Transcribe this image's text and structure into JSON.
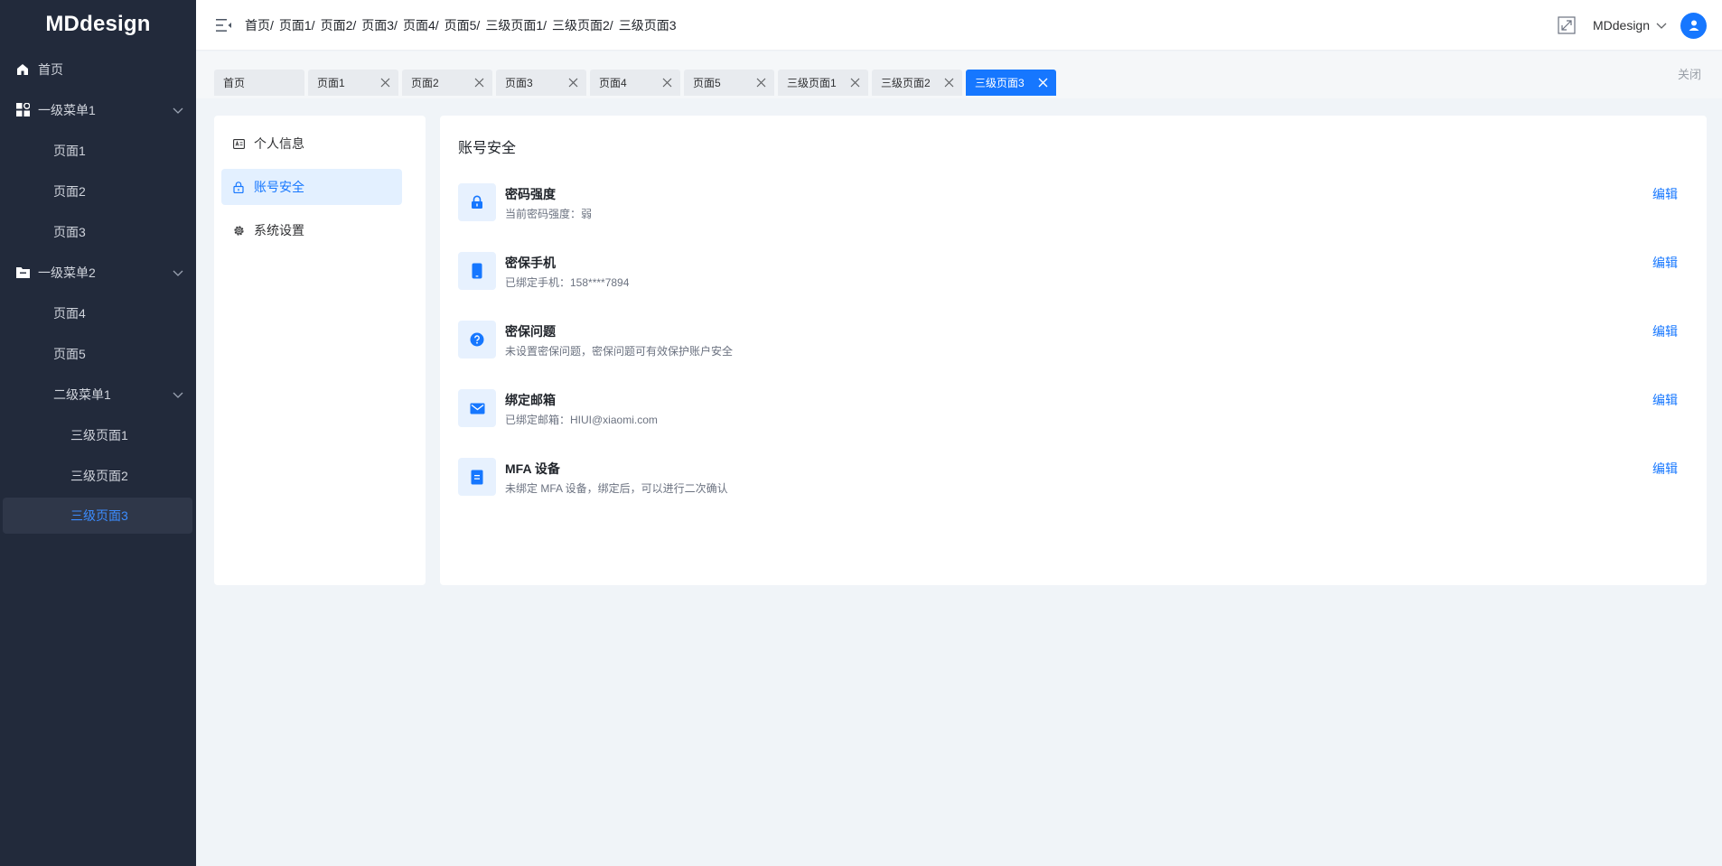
{
  "app": {
    "logo": "MDdesign"
  },
  "sidebar": {
    "items": [
      {
        "label": "首页",
        "icon": "home-icon"
      },
      {
        "label": "一级菜单1",
        "icon": "apps-icon"
      },
      {
        "label": "页面1"
      },
      {
        "label": "页面2"
      },
      {
        "label": "页面3"
      },
      {
        "label": "一级菜单2",
        "icon": "folder-icon"
      },
      {
        "label": "页面4"
      },
      {
        "label": "页面5"
      },
      {
        "label": "二级菜单1"
      },
      {
        "label": "三级页面1"
      },
      {
        "label": "三级页面2"
      },
      {
        "label": "三级页面3"
      }
    ]
  },
  "header": {
    "breadcrumb": [
      "首页/",
      "页面1/",
      "页面2/",
      "页面3/",
      "页面4/",
      "页面5/",
      "三级页面1/",
      "三级页面2/",
      "三级页面3"
    ],
    "user_name": "MDdesign"
  },
  "tabs": {
    "items": [
      {
        "label": "首页"
      },
      {
        "label": "页面1"
      },
      {
        "label": "页面2"
      },
      {
        "label": "页面3"
      },
      {
        "label": "页面4"
      },
      {
        "label": "页面5"
      },
      {
        "label": "三级页面1"
      },
      {
        "label": "三级页面2"
      },
      {
        "label": "三级页面3"
      }
    ],
    "close_all": "关闭"
  },
  "settings_nav": {
    "items": [
      {
        "label": "个人信息",
        "icon": "id-card-icon"
      },
      {
        "label": "账号安全",
        "icon": "lock-icon"
      },
      {
        "label": "系统设置",
        "icon": "gear-icon"
      }
    ]
  },
  "security": {
    "title": "账号安全",
    "edit_label": "编辑",
    "rows": [
      {
        "title": "密码强度",
        "desc": "当前密码强度：弱",
        "icon": "lock-icon"
      },
      {
        "title": "密保手机",
        "desc": "已绑定手机：158****7894",
        "icon": "phone-icon"
      },
      {
        "title": "密保问题",
        "desc": "未设置密保问题，密保问题可有效保护账户安全",
        "icon": "question-icon"
      },
      {
        "title": "绑定邮箱",
        "desc": "已绑定邮箱：HIUI@xiaomi.com",
        "icon": "mail-icon"
      },
      {
        "title": "MFA 设备",
        "desc": "未绑定 MFA 设备，绑定后，可以进行二次确认",
        "icon": "device-icon"
      }
    ]
  },
  "colors": {
    "accent": "#1677ff",
    "sidebar_bg": "#222a3b",
    "page_bg": "#f0f4f8"
  }
}
